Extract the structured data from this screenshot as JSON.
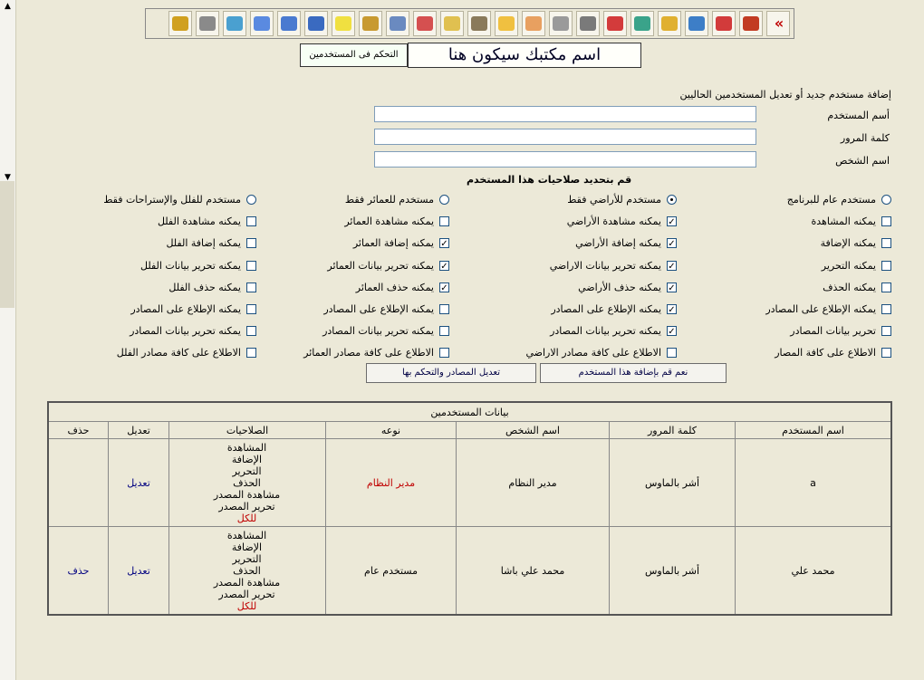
{
  "toolbar": {
    "icons": [
      "nav-chevrons-icon",
      "home-icon",
      "folder-red-icon",
      "folder-blue-icon",
      "folder-open-icon",
      "folder-green-icon",
      "boxes-icon",
      "drive-in-icon",
      "drive-icon",
      "document-edit-icon",
      "weather-icon",
      "tools-icon",
      "clipboard-icon",
      "notepad-icon",
      "users-icon",
      "document-arrow-icon",
      "sticky-note-icon",
      "save-icon",
      "save-alt-icon",
      "globe-icon",
      "network-icon",
      "printer-icon",
      "lock-icon"
    ],
    "chevrons": "«",
    "colors": [
      "#c00000",
      "#c23b22",
      "#d23b3b",
      "#3d7ec7",
      "#e0b030",
      "#3aa38a",
      "#d33b3b",
      "#7a7a7a",
      "#9a9a9a",
      "#e8a060",
      "#f0c040",
      "#8a7a5a",
      "#e0c050",
      "#d55050",
      "#6a8ac0",
      "#c89a30",
      "#f0e040",
      "#3a6ac0",
      "#4a7ad0",
      "#5a8ae0",
      "#4aa0d0",
      "#8a8a8a",
      "#d0a020"
    ]
  },
  "header": {
    "office_name": "اسم مكتبك سيكون هنا",
    "control_button": "التحكم فى المستخدمين"
  },
  "form": {
    "title": "إضافة مستخدم جديد أو تعديل المستخدمين الحاليين",
    "username_label": "أسم المستخدم",
    "password_label": "كلمة المرور",
    "person_label": "اسم الشخص",
    "username_value": "",
    "password_value": "",
    "person_value": "",
    "permissions_title": "قم بتحديد صلاحيات هذا المستخدم"
  },
  "columns": [
    {
      "radio_label": "مستخدم عام للبرنامج",
      "radio_selected": false,
      "checks": [
        {
          "label": "يمكنه المشاهدة",
          "checked": false
        },
        {
          "label": "يمكنه الإضافة",
          "checked": false
        },
        {
          "label": "يمكنه التحرير",
          "checked": false
        },
        {
          "label": "يمكنه الحذف",
          "checked": false
        },
        {
          "label": "يمكنه الإطلاع على المصادر",
          "checked": false
        },
        {
          "label": "تحرير بيانات المصادر",
          "checked": false
        },
        {
          "label": "الاطلاع على كافة المصار",
          "checked": false
        }
      ]
    },
    {
      "radio_label": "مستخدم للأراضي فقط",
      "radio_selected": true,
      "checks": [
        {
          "label": "يمكنه مشاهدة الأراضي",
          "checked": true
        },
        {
          "label": "يمكنه إضافة الأراضي",
          "checked": true
        },
        {
          "label": "يمكنه تحرير بيانات الاراضي",
          "checked": true
        },
        {
          "label": "يمكنه حذف الأراضي",
          "checked": true
        },
        {
          "label": "يمكنه الإطلاع على المصادر",
          "checked": true
        },
        {
          "label": "يمكنه تحرير بيانات المصادر",
          "checked": true
        },
        {
          "label": "الاطلاع على كافة مصادر الاراضي",
          "checked": false
        }
      ]
    },
    {
      "radio_label": "مستخدم للعمائر فقط",
      "radio_selected": false,
      "checks": [
        {
          "label": "يمكنه مشاهدة العمائر",
          "checked": false
        },
        {
          "label": "يمكنه إضافة العمائر",
          "checked": true
        },
        {
          "label": "يمكنه تحرير بيانات العمائر",
          "checked": true
        },
        {
          "label": "يمكنه حذف العمائر",
          "checked": true
        },
        {
          "label": "يمكنه الإطلاع على المصادر",
          "checked": false
        },
        {
          "label": "يمكنه تحرير بيانات المصادر",
          "checked": false
        },
        {
          "label": "الاطلاع على كافة مصادر العمائر",
          "checked": false
        }
      ]
    },
    {
      "radio_label": "مستخدم للفلل والإستراحات فقط",
      "radio_selected": false,
      "checks": [
        {
          "label": "يمكنه مشاهدة الفلل",
          "checked": false
        },
        {
          "label": "يمكنه إضافة الفلل",
          "checked": false
        },
        {
          "label": "يمكنه تحرير بيانات الفلل",
          "checked": false
        },
        {
          "label": "يمكنه حذف الفلل",
          "checked": false
        },
        {
          "label": "يمكنه الإطلاع على المصادر",
          "checked": false
        },
        {
          "label": "يمكنه تحرير بيانات المصادر",
          "checked": false
        },
        {
          "label": "الاطلاع على كافة مصادر الفلل",
          "checked": false
        }
      ]
    }
  ],
  "buttons": {
    "add_user": "نعم قم بإضافة هذا المستخدم",
    "edit_sources": "تعديل المصادر والتحكم بها"
  },
  "table": {
    "caption": "بيانات المستخدمين",
    "headers": [
      "اسم المستخدم",
      "كلمة المرور",
      "اسم الشخص",
      "نوعه",
      "الصلاحيات",
      "تعديل",
      "حذف"
    ],
    "rows": [
      {
        "username": "a",
        "password": "أشر بالماوس",
        "person": "مدير النظام",
        "type": "مدير النظام",
        "permissions": [
          "المشاهدة",
          "الإضافة",
          "التحرير",
          "الحذف",
          "مشاهدة المصدر",
          "تحرير المصدر"
        ],
        "scope": "للكل",
        "edit": "تعديل",
        "delete": ""
      },
      {
        "username": "محمد علي",
        "password": "أشر بالماوس",
        "person": "محمد علي باشا",
        "type": "مستخدم عام",
        "permissions": [
          "المشاهدة",
          "الإضافة",
          "التحرير",
          "الحذف",
          "مشاهدة المصدر",
          "تحرير المصدر"
        ],
        "scope": "للكل",
        "edit": "تعديل",
        "delete": "حذف"
      }
    ]
  }
}
